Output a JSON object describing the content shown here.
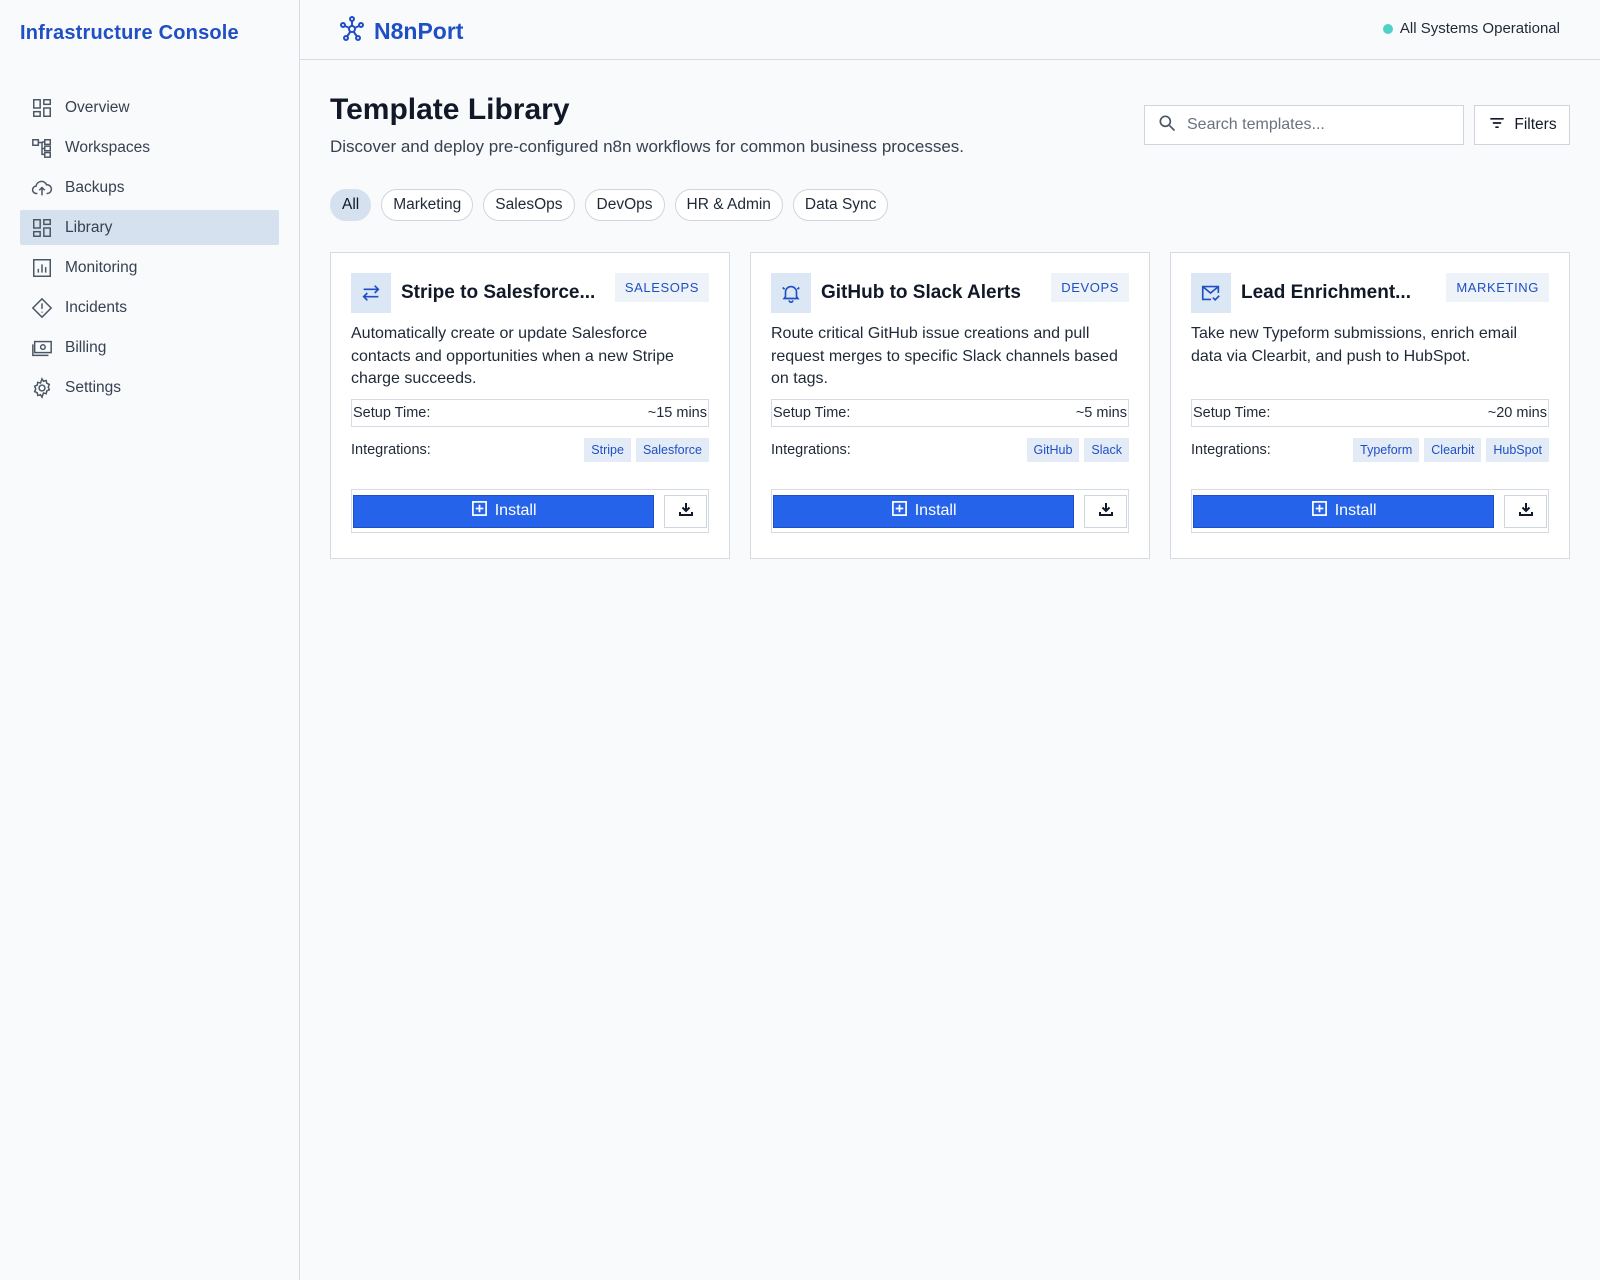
{
  "sidebar": {
    "brand": "Infrastructure Console",
    "items": [
      {
        "label": "Overview",
        "icon": "dashboard-icon",
        "active": false
      },
      {
        "label": "Workspaces",
        "icon": "hierarchy-icon",
        "active": false
      },
      {
        "label": "Backups",
        "icon": "cloud-upload-icon",
        "active": false
      },
      {
        "label": "Library",
        "icon": "dashboard-icon",
        "active": true
      },
      {
        "label": "Monitoring",
        "icon": "bar-chart-icon",
        "active": false
      },
      {
        "label": "Incidents",
        "icon": "warning-diamond-icon",
        "active": false
      },
      {
        "label": "Billing",
        "icon": "money-icon",
        "active": false
      },
      {
        "label": "Settings",
        "icon": "gear-icon",
        "active": false
      }
    ]
  },
  "header": {
    "app_name": "N8nPort",
    "status_text": "All Systems Operational",
    "status_color": "#4fd1c5"
  },
  "main": {
    "title": "Template Library",
    "subtitle": "Discover and deploy pre-configured n8n workflows for common business processes.",
    "search_placeholder": "Search templates...",
    "filters_label": "Filters",
    "chips": [
      "All",
      "Marketing",
      "SalesOps",
      "DevOps",
      "HR & Admin",
      "Data Sync"
    ],
    "active_chip": "All",
    "setup_label": "Setup Time:",
    "integrations_label": "Integrations:",
    "install_label": "Install",
    "cards": [
      {
        "icon": "swap-arrows-icon",
        "title": "Stripe to Salesforce...",
        "badge": "SALESOPS",
        "description": "Automatically create or update Salesforce contacts and opportunities when a new Stripe charge succeeds.",
        "setup_time": "~15 mins",
        "integrations": [
          "Stripe",
          "Salesforce"
        ]
      },
      {
        "icon": "bell-icon",
        "title": "GitHub to Slack Alerts",
        "badge": "DEVOPS",
        "description": "Route critical GitHub issue creations and pull request merges to specific Slack channels based on tags.",
        "setup_time": "~5 mins",
        "integrations": [
          "GitHub",
          "Slack"
        ]
      },
      {
        "icon": "mail-check-icon",
        "title": "Lead Enrichment...",
        "badge": "MARKETING",
        "description": "Take new Typeform submissions, enrich email data via Clearbit, and push to HubSpot.",
        "setup_time": "~20 mins",
        "integrations": [
          "Typeform",
          "Clearbit",
          "HubSpot"
        ]
      }
    ]
  },
  "colors": {
    "accent": "#1e4fc4",
    "primary_button": "#2563eb",
    "active_bg": "#d5e1ee"
  }
}
